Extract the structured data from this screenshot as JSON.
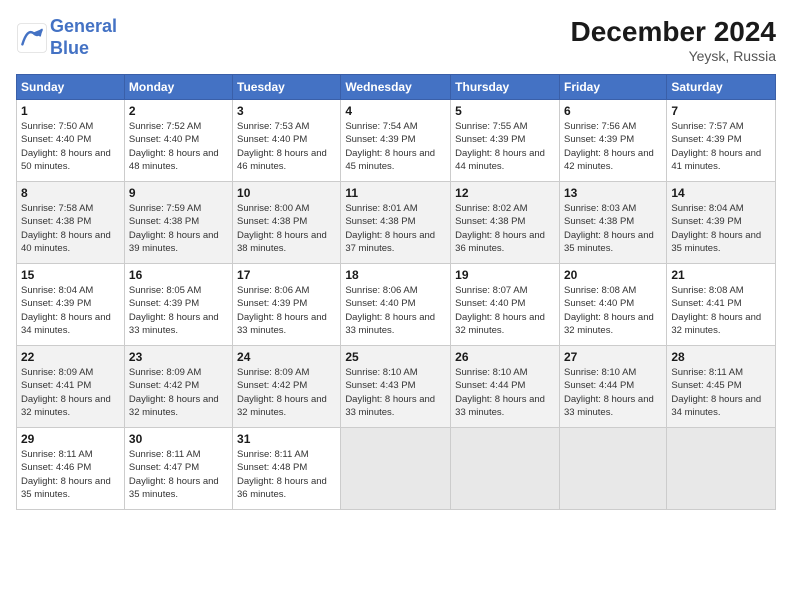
{
  "header": {
    "logo_line1": "General",
    "logo_line2": "Blue",
    "month_year": "December 2024",
    "location": "Yeysk, Russia"
  },
  "weekdays": [
    "Sunday",
    "Monday",
    "Tuesday",
    "Wednesday",
    "Thursday",
    "Friday",
    "Saturday"
  ],
  "weeks": [
    [
      {
        "day": "1",
        "sunrise": "7:50 AM",
        "sunset": "4:40 PM",
        "daylight": "8 hours and 50 minutes."
      },
      {
        "day": "2",
        "sunrise": "7:52 AM",
        "sunset": "4:40 PM",
        "daylight": "8 hours and 48 minutes."
      },
      {
        "day": "3",
        "sunrise": "7:53 AM",
        "sunset": "4:40 PM",
        "daylight": "8 hours and 46 minutes."
      },
      {
        "day": "4",
        "sunrise": "7:54 AM",
        "sunset": "4:39 PM",
        "daylight": "8 hours and 45 minutes."
      },
      {
        "day": "5",
        "sunrise": "7:55 AM",
        "sunset": "4:39 PM",
        "daylight": "8 hours and 44 minutes."
      },
      {
        "day": "6",
        "sunrise": "7:56 AM",
        "sunset": "4:39 PM",
        "daylight": "8 hours and 42 minutes."
      },
      {
        "day": "7",
        "sunrise": "7:57 AM",
        "sunset": "4:39 PM",
        "daylight": "8 hours and 41 minutes."
      }
    ],
    [
      {
        "day": "8",
        "sunrise": "7:58 AM",
        "sunset": "4:38 PM",
        "daylight": "8 hours and 40 minutes."
      },
      {
        "day": "9",
        "sunrise": "7:59 AM",
        "sunset": "4:38 PM",
        "daylight": "8 hours and 39 minutes."
      },
      {
        "day": "10",
        "sunrise": "8:00 AM",
        "sunset": "4:38 PM",
        "daylight": "8 hours and 38 minutes."
      },
      {
        "day": "11",
        "sunrise": "8:01 AM",
        "sunset": "4:38 PM",
        "daylight": "8 hours and 37 minutes."
      },
      {
        "day": "12",
        "sunrise": "8:02 AM",
        "sunset": "4:38 PM",
        "daylight": "8 hours and 36 minutes."
      },
      {
        "day": "13",
        "sunrise": "8:03 AM",
        "sunset": "4:38 PM",
        "daylight": "8 hours and 35 minutes."
      },
      {
        "day": "14",
        "sunrise": "8:04 AM",
        "sunset": "4:39 PM",
        "daylight": "8 hours and 35 minutes."
      }
    ],
    [
      {
        "day": "15",
        "sunrise": "8:04 AM",
        "sunset": "4:39 PM",
        "daylight": "8 hours and 34 minutes."
      },
      {
        "day": "16",
        "sunrise": "8:05 AM",
        "sunset": "4:39 PM",
        "daylight": "8 hours and 33 minutes."
      },
      {
        "day": "17",
        "sunrise": "8:06 AM",
        "sunset": "4:39 PM",
        "daylight": "8 hours and 33 minutes."
      },
      {
        "day": "18",
        "sunrise": "8:06 AM",
        "sunset": "4:40 PM",
        "daylight": "8 hours and 33 minutes."
      },
      {
        "day": "19",
        "sunrise": "8:07 AM",
        "sunset": "4:40 PM",
        "daylight": "8 hours and 32 minutes."
      },
      {
        "day": "20",
        "sunrise": "8:08 AM",
        "sunset": "4:40 PM",
        "daylight": "8 hours and 32 minutes."
      },
      {
        "day": "21",
        "sunrise": "8:08 AM",
        "sunset": "4:41 PM",
        "daylight": "8 hours and 32 minutes."
      }
    ],
    [
      {
        "day": "22",
        "sunrise": "8:09 AM",
        "sunset": "4:41 PM",
        "daylight": "8 hours and 32 minutes."
      },
      {
        "day": "23",
        "sunrise": "8:09 AM",
        "sunset": "4:42 PM",
        "daylight": "8 hours and 32 minutes."
      },
      {
        "day": "24",
        "sunrise": "8:09 AM",
        "sunset": "4:42 PM",
        "daylight": "8 hours and 32 minutes."
      },
      {
        "day": "25",
        "sunrise": "8:10 AM",
        "sunset": "4:43 PM",
        "daylight": "8 hours and 33 minutes."
      },
      {
        "day": "26",
        "sunrise": "8:10 AM",
        "sunset": "4:44 PM",
        "daylight": "8 hours and 33 minutes."
      },
      {
        "day": "27",
        "sunrise": "8:10 AM",
        "sunset": "4:44 PM",
        "daylight": "8 hours and 33 minutes."
      },
      {
        "day": "28",
        "sunrise": "8:11 AM",
        "sunset": "4:45 PM",
        "daylight": "8 hours and 34 minutes."
      }
    ],
    [
      {
        "day": "29",
        "sunrise": "8:11 AM",
        "sunset": "4:46 PM",
        "daylight": "8 hours and 35 minutes."
      },
      {
        "day": "30",
        "sunrise": "8:11 AM",
        "sunset": "4:47 PM",
        "daylight": "8 hours and 35 minutes."
      },
      {
        "day": "31",
        "sunrise": "8:11 AM",
        "sunset": "4:48 PM",
        "daylight": "8 hours and 36 minutes."
      },
      null,
      null,
      null,
      null
    ]
  ]
}
